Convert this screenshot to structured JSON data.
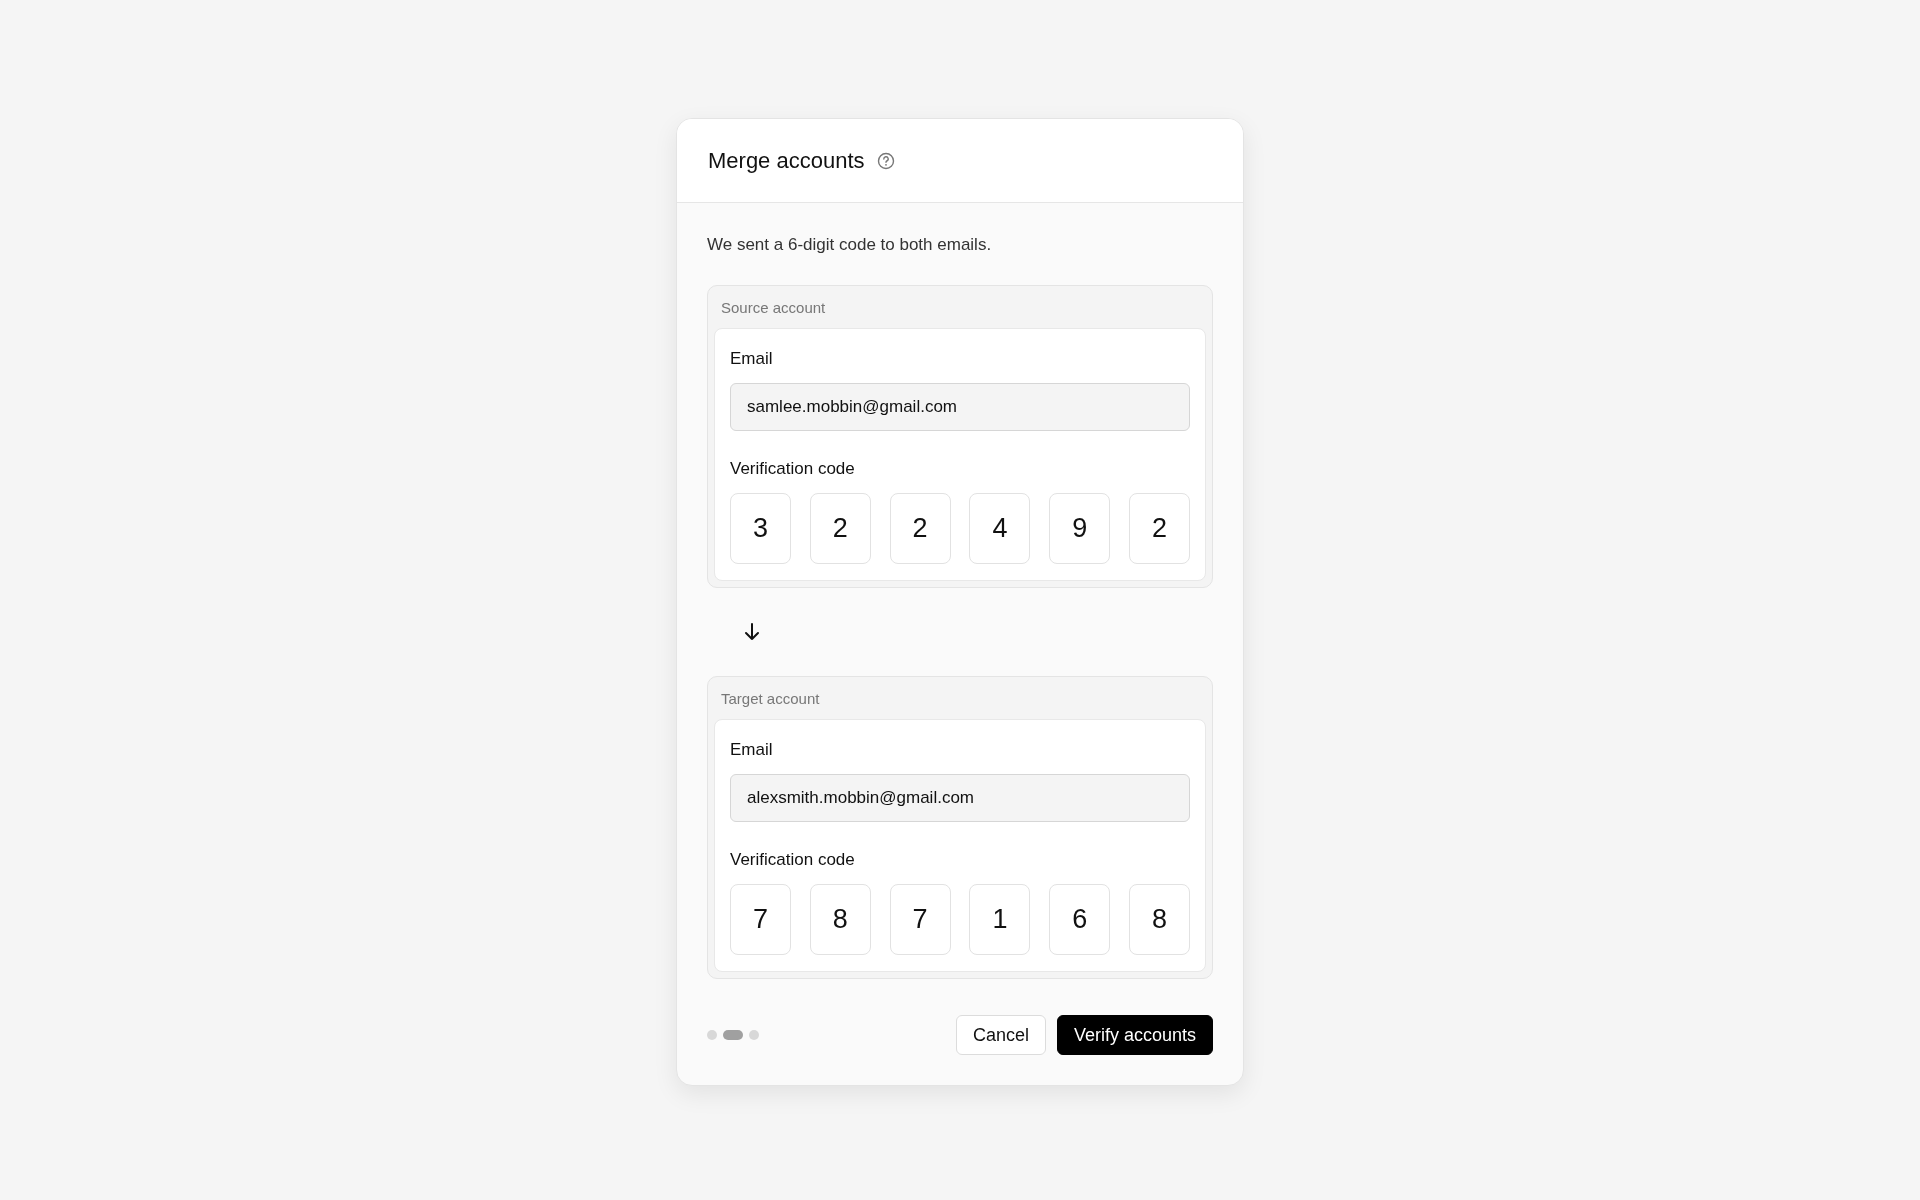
{
  "dialog": {
    "title": "Merge accounts",
    "message": "We sent a 6-digit code to both emails.",
    "accounts": [
      {
        "heading": "Source account",
        "email_label": "Email",
        "email": "samlee.mobbin@gmail.com",
        "code_label": "Verification code",
        "code": [
          "3",
          "2",
          "2",
          "4",
          "9",
          "2"
        ]
      },
      {
        "heading": "Target account",
        "email_label": "Email",
        "email": "alexsmith.mobbin@gmail.com",
        "code_label": "Verification code",
        "code": [
          "7",
          "8",
          "7",
          "1",
          "6",
          "8"
        ]
      }
    ],
    "steps": [
      {
        "selected": false
      },
      {
        "selected": true
      },
      {
        "selected": false
      }
    ],
    "buttons": [
      {
        "label": "Cancel",
        "kind": "secondary"
      },
      {
        "label": "Verify accounts",
        "kind": "primary"
      }
    ]
  }
}
